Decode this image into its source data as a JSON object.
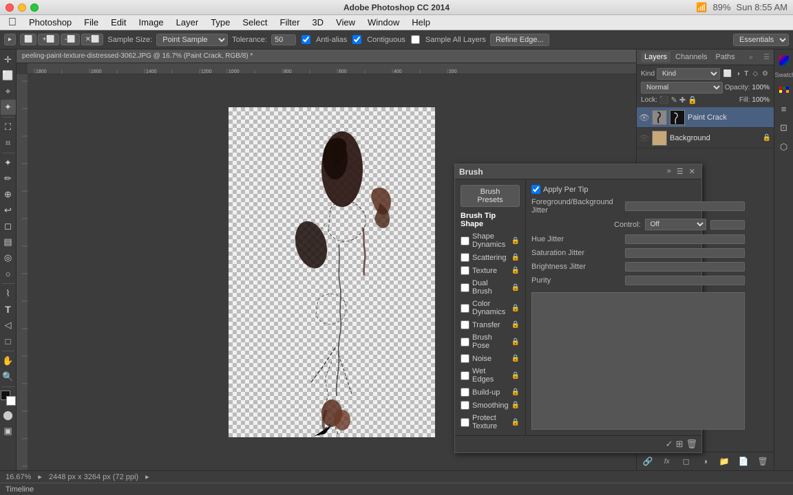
{
  "app": {
    "name": "Adobe Photoshop CC 2014",
    "title": "Adobe Photoshop CC 2014"
  },
  "titlebar": {
    "title": "Adobe Photoshop CC 2014",
    "battery": "89%",
    "time": "Sun 8:55 AM"
  },
  "menubar": {
    "apple": "⌘",
    "items": [
      "Photoshop",
      "File",
      "Edit",
      "Image",
      "Layer",
      "Type",
      "Select",
      "Filter",
      "3D",
      "View",
      "Window",
      "Help"
    ]
  },
  "optionsbar": {
    "sample_size_label": "Sample Size:",
    "sample_size_value": "Point Sample",
    "tolerance_label": "Tolerance:",
    "tolerance_value": "50",
    "anti_alias_label": "Anti-alias",
    "contiguous_label": "Contiguous",
    "sample_all_label": "Sample All Layers",
    "refine_edge_label": "Refine Edge..."
  },
  "document": {
    "tab_label": "peeling-paint-texture-distressed-3062.JPG @ 16.7% (Paint Crack, RGB/8) *",
    "zoom": "16.67%",
    "dimensions": "2448 px x 3264 px (72 ppi)"
  },
  "layers_panel": {
    "tabs": [
      "Layers",
      "Channels",
      "Paths"
    ],
    "active_tab": "Layers",
    "kind_label": "Kind",
    "blend_mode": "Normal",
    "opacity_label": "Opacity:",
    "opacity_value": "100%",
    "fill_label": "Fill:",
    "fill_value": "100%",
    "lock_label": "Lock:",
    "layers": [
      {
        "name": "Paint Crack",
        "visible": true,
        "active": true,
        "has_mask": true
      },
      {
        "name": "Background",
        "visible": false,
        "active": false,
        "locked": true
      }
    ]
  },
  "right_panel_icons": [
    {
      "label": "Color",
      "icon": "●"
    },
    {
      "label": "Swatches",
      "icon": "▦"
    },
    {
      "label": "Layers",
      "icon": "≡"
    },
    {
      "label": "Channels",
      "icon": "⊡"
    },
    {
      "label": "Paths",
      "icon": "⬠"
    }
  ],
  "brush_panel": {
    "title": "Brush",
    "presets_btn": "Brush Presets",
    "apply_per_tip": "Apply Per Tip",
    "sections": [
      {
        "label": "Brush Tip Shape",
        "locked": false,
        "active": true
      },
      {
        "label": "Shape Dynamics",
        "locked": true
      },
      {
        "label": "Scattering",
        "locked": true
      },
      {
        "label": "Texture",
        "locked": true
      },
      {
        "label": "Dual Brush",
        "locked": true
      },
      {
        "label": "Color Dynamics",
        "locked": true
      },
      {
        "label": "Transfer",
        "locked": true
      },
      {
        "label": "Brush Pose",
        "locked": true
      },
      {
        "label": "Noise",
        "locked": true
      },
      {
        "label": "Wet Edges",
        "locked": true
      },
      {
        "label": "Build-up",
        "locked": true
      },
      {
        "label": "Smoothing",
        "locked": true
      },
      {
        "label": "Protect Texture",
        "locked": true
      }
    ],
    "properties": [
      {
        "label": "Foreground/Background Jitter"
      },
      {
        "label": "Control:",
        "control_value": "Off"
      },
      {
        "label": "Hue Jitter"
      },
      {
        "label": "Saturation Jitter"
      },
      {
        "label": "Brightness Jitter"
      },
      {
        "label": "Purity"
      }
    ]
  },
  "statusbar": {
    "zoom": "16.67%",
    "dimensions": "2448 px x 3264 px (72 ppi)"
  },
  "timeline": {
    "label": "Timeline"
  },
  "panel_actions": {
    "link": "🔗",
    "fx": "fx",
    "new_layer": "📄",
    "new_group": "📁",
    "delete": "🗑"
  }
}
